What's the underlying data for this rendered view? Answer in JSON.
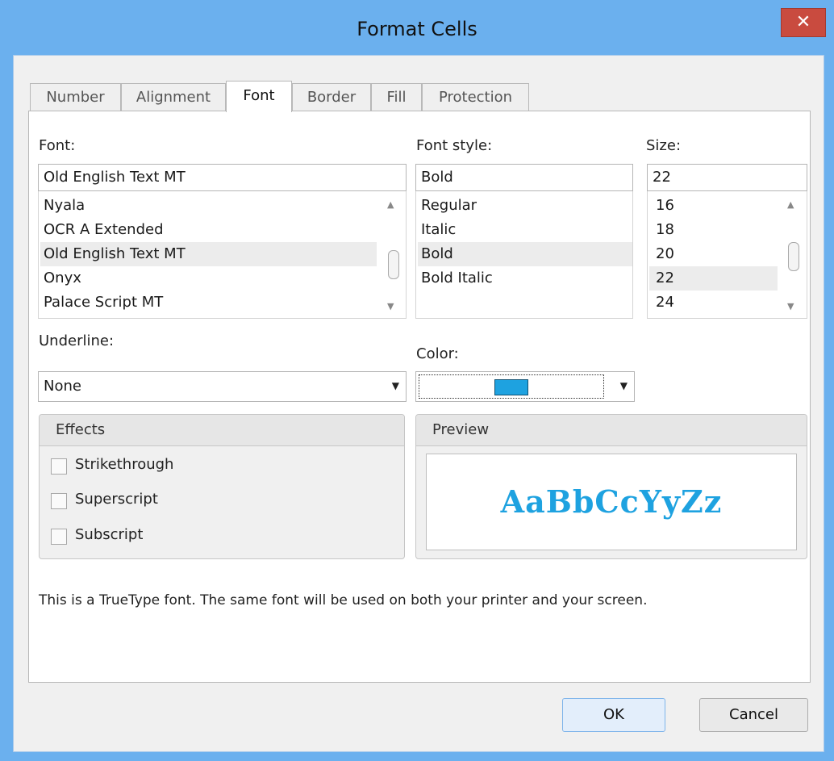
{
  "window": {
    "title": "Format Cells",
    "close_glyph": "✕"
  },
  "tabs": [
    {
      "label": "Number"
    },
    {
      "label": "Alignment"
    },
    {
      "label": "Font"
    },
    {
      "label": "Border"
    },
    {
      "label": "Fill"
    },
    {
      "label": "Protection"
    }
  ],
  "active_tab": "Font",
  "font": {
    "label": "Font:",
    "value": "Old English Text MT",
    "items": [
      "Nyala",
      "OCR A Extended",
      "Old English Text MT",
      "Onyx",
      "Palace Script MT"
    ],
    "selected": "Old English Text MT"
  },
  "font_style": {
    "label": "Font style:",
    "value": "Bold",
    "items": [
      "Regular",
      "Italic",
      "Bold",
      "Bold Italic"
    ],
    "selected": "Bold"
  },
  "size": {
    "label": "Size:",
    "value": "22",
    "items": [
      "16",
      "18",
      "20",
      "22",
      "24"
    ],
    "selected": "22"
  },
  "underline": {
    "label": "Underline:",
    "value": "None"
  },
  "color": {
    "label": "Color:",
    "swatch": "#1ea2e0"
  },
  "effects": {
    "title": "Effects",
    "options": [
      {
        "label": "Strikethrough",
        "checked": false
      },
      {
        "label": "Superscript",
        "checked": false
      },
      {
        "label": "Subscript",
        "checked": false
      }
    ]
  },
  "preview": {
    "title": "Preview",
    "sample": "AaBbCcYyZz"
  },
  "info_text": "This is a TrueType font. The same font will be used on both your printer and your screen.",
  "buttons": {
    "ok": "OK",
    "cancel": "Cancel"
  }
}
